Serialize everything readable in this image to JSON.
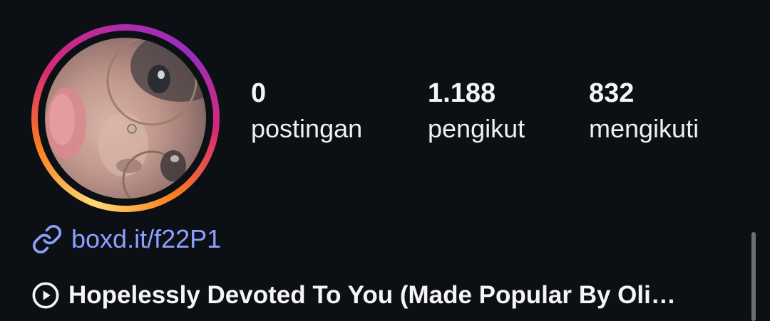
{
  "profile": {
    "avatar_alt": "profile photo",
    "has_story_ring": true
  },
  "stats": {
    "posts": {
      "count": "0",
      "label": "postingan"
    },
    "followers": {
      "count": "1.188",
      "label": "pengikut"
    },
    "following": {
      "count": "832",
      "label": "mengikuti"
    }
  },
  "bio": {
    "link_text": "boxd.it/f22P1",
    "link_icon": "link-icon",
    "music_icon": "play-circle-icon",
    "music_title": "Hopelessly Devoted To You (Made Popular By Oli…"
  },
  "colors": {
    "background": "#0c0f14",
    "link": "#8ea0ff",
    "text": "#f5f5f5"
  }
}
